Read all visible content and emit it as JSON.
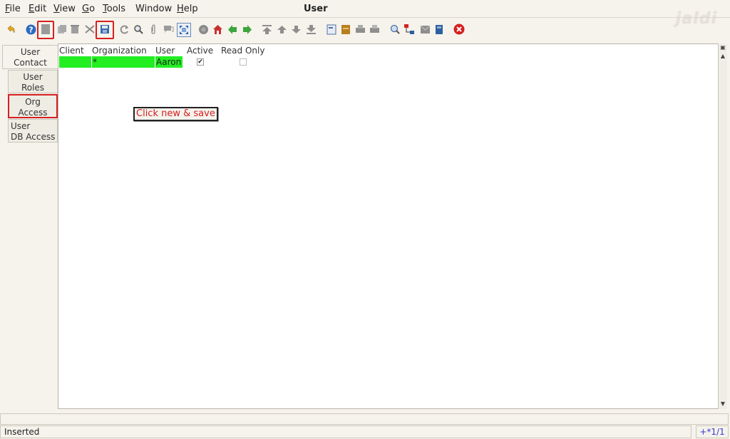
{
  "menubar": {
    "items": [
      "File",
      "Edit",
      "View",
      "Go",
      "Tools",
      "Window",
      "Help"
    ],
    "title": "User",
    "logo": "jaldi"
  },
  "tabs": [
    {
      "label_1": "User",
      "label_2": "Contact"
    },
    {
      "label_1": "User",
      "label_2": "Roles"
    },
    {
      "label_1": "Org",
      "label_2": "Access"
    },
    {
      "label_1": "User",
      "label_2": "DB Access"
    }
  ],
  "grid": {
    "columns": [
      "Client",
      "Organization",
      "User",
      "Active",
      "Read Only"
    ],
    "row": {
      "client": "",
      "organization": "*",
      "user": "Aaron",
      "active": "✔",
      "read_only": ""
    }
  },
  "callout": "Click new & save",
  "status": {
    "message": "Inserted",
    "record": "+*1/1"
  },
  "colors": {
    "highlight": "#d62020",
    "row_fill": "#22ee22",
    "record_text": "#3a3ad0"
  }
}
